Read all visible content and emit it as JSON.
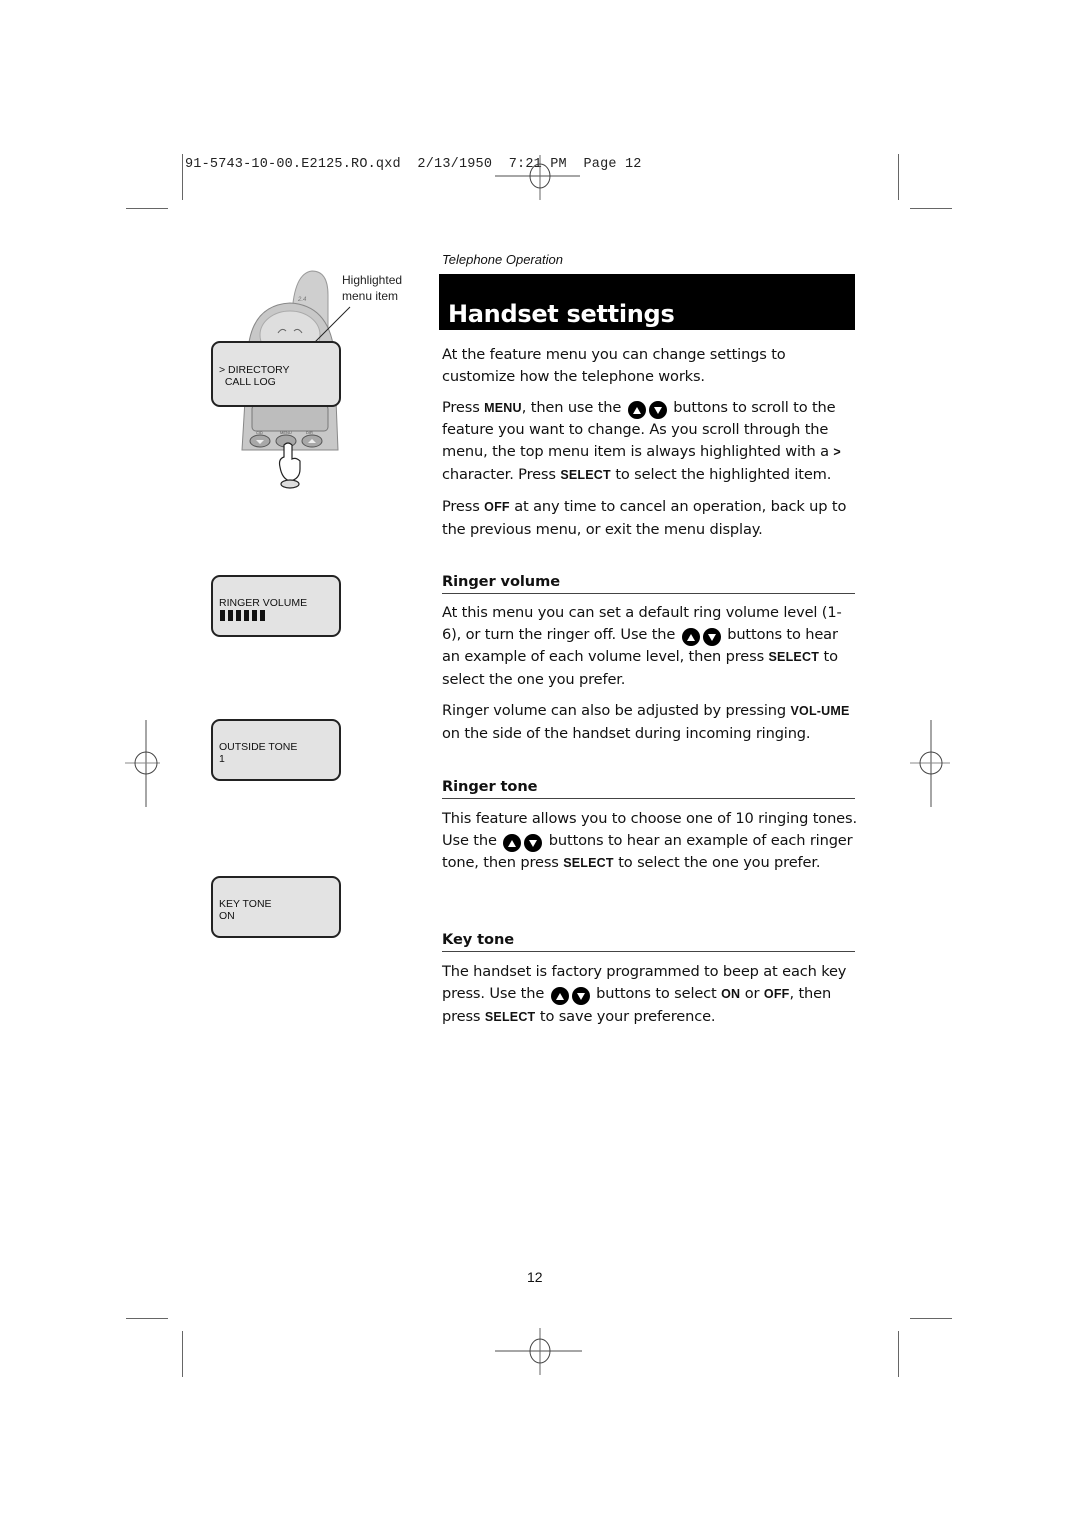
{
  "print_slug": "91-5743-10-00.E2125.RO.qxd  2/13/1950  7:21 PM  Page 12",
  "section_label": "Telephone Operation",
  "page_title": "Handset settings",
  "intro": {
    "p1": "At the feature menu you can change settings to customize how the telephone works.",
    "p2": {
      "a": "Press ",
      "menu_key": "MENU",
      "b": ", then use the ",
      "c": " buttons to scroll to the feature you want to change. As you scroll through the menu, the top menu item is always highlighted with a ",
      "gt": ">",
      "d": " character. Press ",
      "select_key": "SELECT",
      "e": " to select the highlighted item."
    },
    "p3": {
      "a": "Press ",
      "off_key": "OFF",
      "b": " at any time to cancel an operation, back up to the previous menu, or exit the menu display."
    }
  },
  "sections": {
    "ringer_volume": {
      "heading": "Ringer volume",
      "p1": {
        "a": "At this menu you can set a default ring volume level (1-6), or turn the ringer off. Use the ",
        "b": " buttons to hear an example of each volume level, then press ",
        "select_key": "SELECT",
        "c": " to select the one you prefer."
      },
      "p2": {
        "a": "Ringer volume can also be adjusted by pressing ",
        "volume_key": "VOL-UME",
        "b": " on the side of the handset during incoming ringing."
      }
    },
    "ringer_tone": {
      "heading": "Ringer tone",
      "p1": {
        "a": "This feature allows you to choose one of 10 ringing tones. Use the ",
        "b": " buttons to hear an example of each ringer tone, then press ",
        "select_key": "SELECT",
        "c": " to select the one you prefer."
      }
    },
    "key_tone": {
      "heading": "Key tone",
      "p1": {
        "a": "The handset is factory programmed to beep at each key press. Use the ",
        "b": " buttons to select ",
        "on_key": "ON",
        "or": " or ",
        "off_key": "OFF",
        "c": ", then press ",
        "select_key": "SELECT",
        "d": " to save your preference."
      }
    }
  },
  "illustrations": {
    "phone": {
      "callout": "Highlighted menu item",
      "antenna_label": "2.4",
      "button_labels": [
        "CID",
        "MENU",
        "DIR"
      ],
      "display_line1": "> DIRECTORY",
      "display_line2": "  CALL LOG"
    },
    "lcd_ringer_volume": {
      "line1": "RINGER VOLUME",
      "volume_level": 6,
      "volume_max": 6
    },
    "lcd_outside_tone": {
      "line1": "OUTSIDE TONE",
      "line2": "1"
    },
    "lcd_key_tone": {
      "line1": "KEY TONE",
      "line2": "ON"
    }
  },
  "page_number": "12"
}
